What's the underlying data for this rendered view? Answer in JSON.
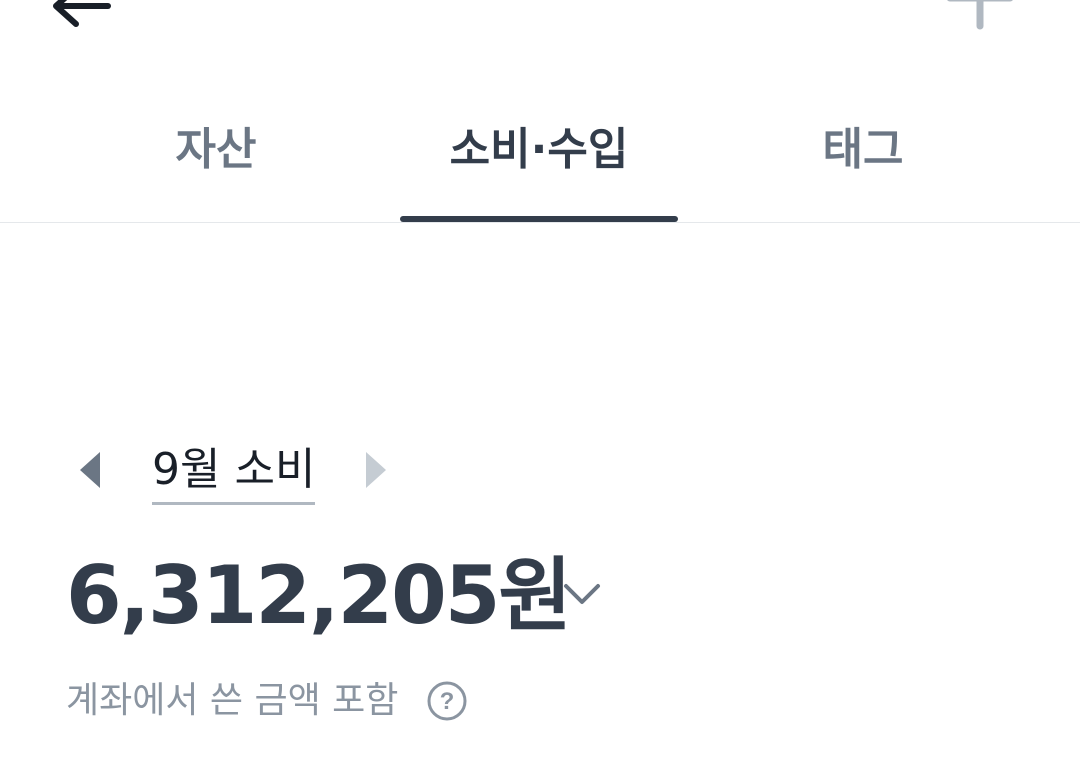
{
  "tabs": [
    {
      "label": "자산",
      "active": false
    },
    {
      "label": "소비·수입",
      "active": true
    },
    {
      "label": "태그",
      "active": false
    }
  ],
  "icons": {
    "back": "back-arrow-icon",
    "add": "plus-icon",
    "prev": "caret-left-icon",
    "next": "caret-right-icon",
    "expand": "chevron-down-icon",
    "help": "question-circle-icon"
  },
  "colors": {
    "text_primary": "#333d4b",
    "text_secondary": "#6b7684",
    "text_muted": "#8b95a1",
    "divider": "#e5e8eb"
  },
  "summary": {
    "month_label": "9월 소비",
    "amount": "6,312,205원",
    "note": "계좌에서 쓴 금액 포함",
    "help_symbol": "?"
  }
}
